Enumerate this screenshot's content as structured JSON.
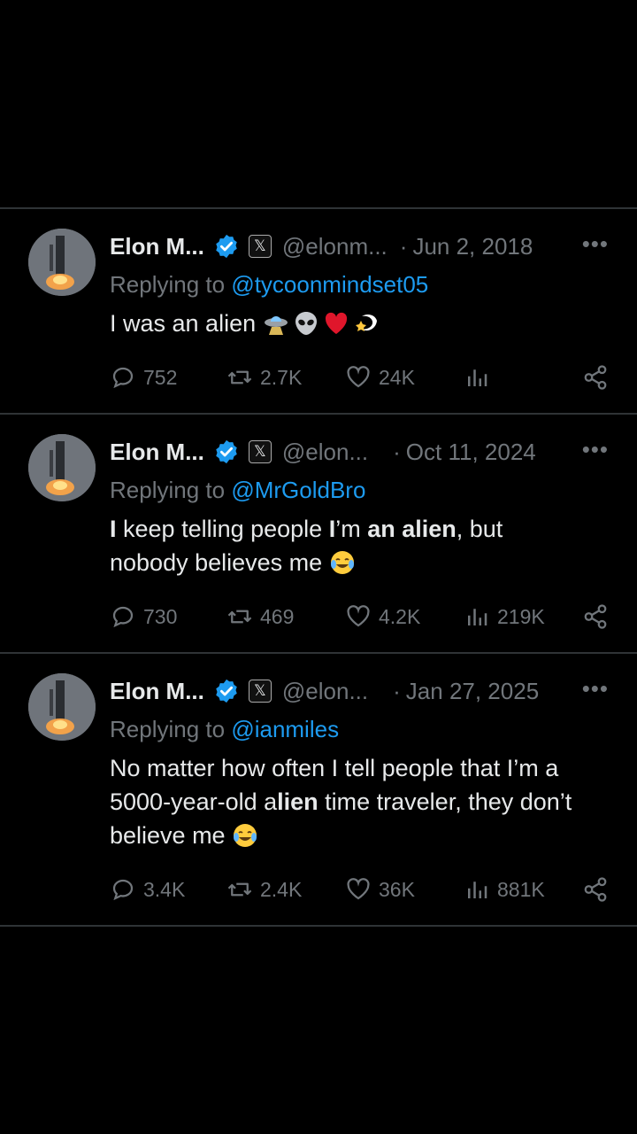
{
  "tweets": [
    {
      "name": "Elon M...",
      "handle": "@elonm...",
      "date": "Jun 2, 2018",
      "reply_prefix": "Replying to",
      "reply_to": "@tycoonmindset05",
      "text_segments": [
        [
          "I was an alien",
          false
        ]
      ],
      "emojis": [
        "flying-saucer",
        "alien",
        "red-heart",
        "dizzy"
      ],
      "replies": "752",
      "reposts": "2.7K",
      "likes": "24K",
      "views": ""
    },
    {
      "name": "Elon M...",
      "handle": "@elon...",
      "date": "Oct 11, 2024",
      "reply_prefix": "Replying to",
      "reply_to": "@MrGoldBro",
      "text_segments": [
        [
          "I",
          true
        ],
        [
          " keep telling people ",
          false
        ],
        [
          "I",
          true
        ],
        [
          "’m ",
          false
        ],
        [
          "an alien",
          true
        ],
        [
          ", but nobody believes me",
          false
        ]
      ],
      "emojis": [
        "tears-of-joy"
      ],
      "replies": "730",
      "reposts": "469",
      "likes": "4.2K",
      "views": "219K"
    },
    {
      "name": "Elon M...",
      "handle": "@elon...",
      "date": "Jan 27, 2025",
      "reply_prefix": "Replying to",
      "reply_to": "@ianmiles",
      "text_segments": [
        [
          "No matter how often I tell people that I’m a 5000-year-old a",
          false
        ],
        [
          "lien",
          true
        ],
        [
          " time traveler, they don’t believe me",
          false
        ]
      ],
      "emojis": [
        "tears-of-joy"
      ],
      "replies": "3.4K",
      "reposts": "2.4K",
      "likes": "36K",
      "views": "881K"
    }
  ],
  "colors": {
    "background": "#000000",
    "text": "#e7e9ea",
    "muted": "#71767b",
    "accent": "#1d9bf0",
    "divider": "#2f3336",
    "verified": "#1d9bf0"
  }
}
